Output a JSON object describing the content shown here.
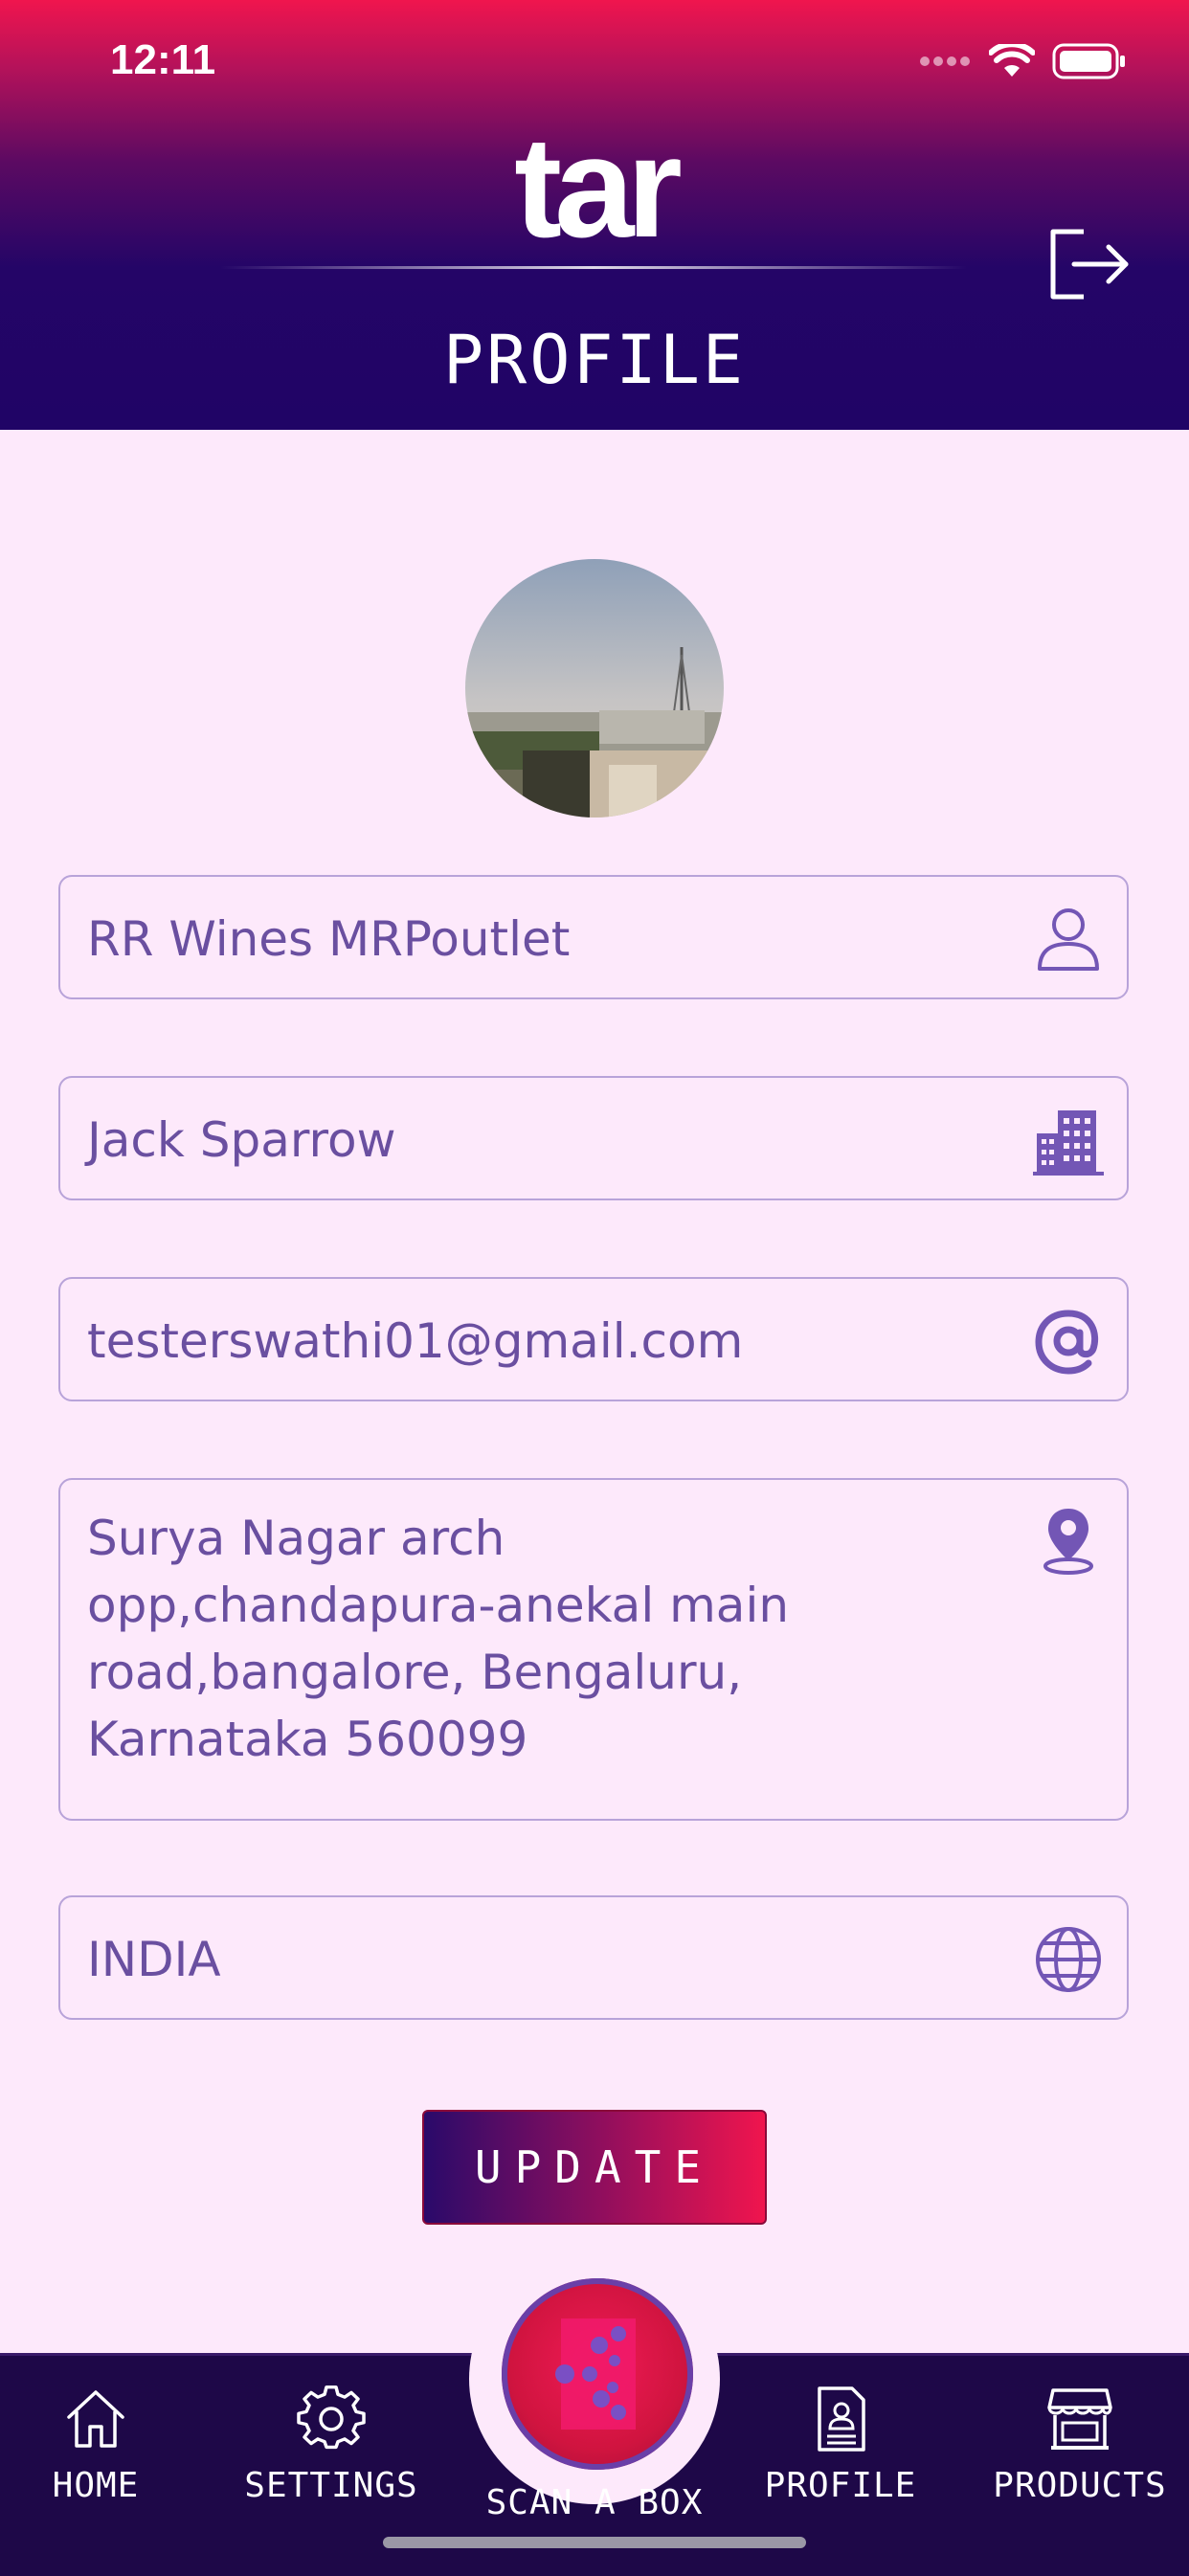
{
  "status_bar": {
    "time": "12:11"
  },
  "header": {
    "logo": "tar",
    "title": "PROFILE"
  },
  "profile": {
    "business_name": "RR Wines MRPoutlet",
    "owner_name": "Jack Sparrow",
    "email": "testerswathi01@gmail.com",
    "address": "Surya Nagar arch\nopp,chandapura-anekal main\nroad,bangalore, Bengaluru,\nKarnataka 560099",
    "country": "INDIA"
  },
  "update_label": "UPDATE",
  "icons": {
    "logout": "logout-icon",
    "business": "person-icon",
    "owner": "building-icon",
    "email": "at-icon",
    "address": "location-pin-icon",
    "country": "globe-icon"
  },
  "tabs": [
    {
      "label": "HOME",
      "icon": "home-icon"
    },
    {
      "label": "SETTINGS",
      "icon": "gear-icon"
    },
    {
      "label": "SCAN A BOX",
      "icon": "scan-icon"
    },
    {
      "label": "PROFILE",
      "icon": "profile-document-icon"
    },
    {
      "label": "PRODUCTS",
      "icon": "store-icon"
    }
  ],
  "colors": {
    "accent": "#f0154e",
    "header_dark": "#200466",
    "field_text": "#6a4fa0",
    "background": "#fde9fb",
    "tabbar": "#1e0848"
  }
}
